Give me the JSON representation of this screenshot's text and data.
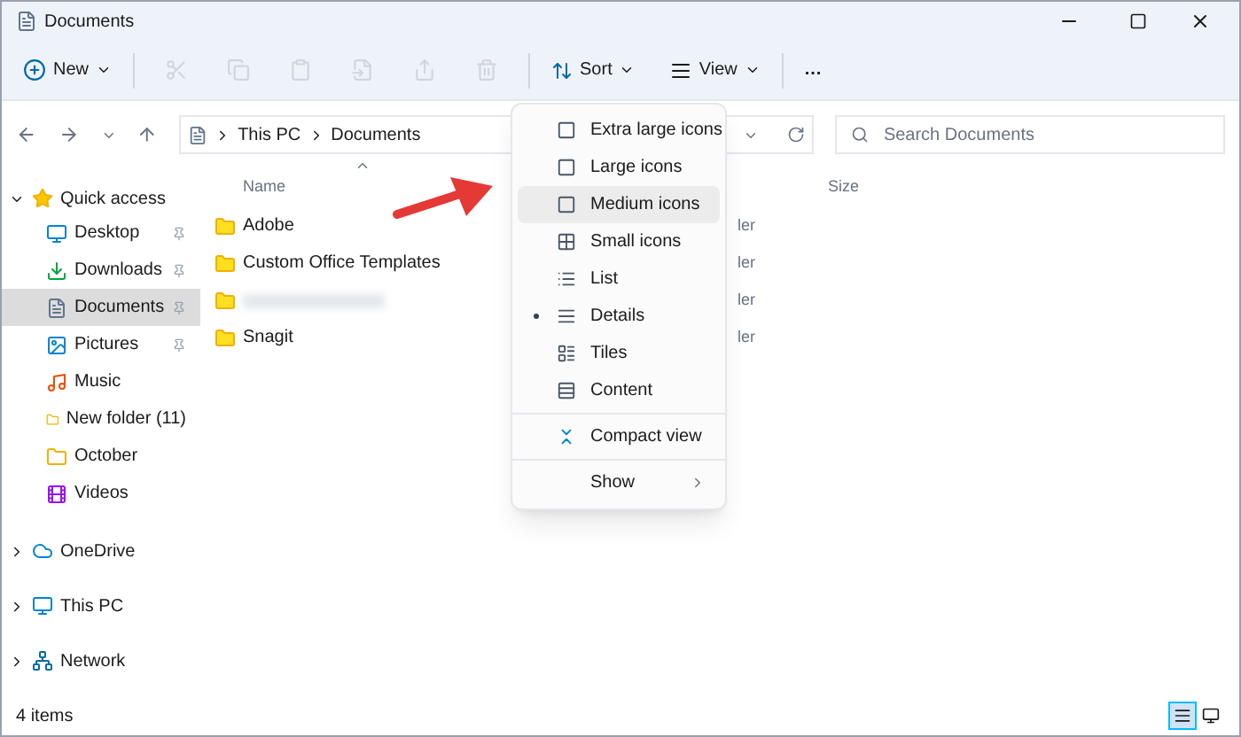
{
  "window": {
    "title": "Documents"
  },
  "toolbar": {
    "new_label": "New",
    "sort_label": "Sort",
    "view_label": "View",
    "more_label": "..."
  },
  "address": {
    "crumbs": [
      "This PC",
      "Documents"
    ],
    "search_placeholder": "Search Documents"
  },
  "columns": [
    "Name",
    "Size"
  ],
  "sidebar": [
    {
      "label": "Quick access",
      "expanded": true,
      "children": [
        {
          "label": "Desktop",
          "pinned": true,
          "selected": false
        },
        {
          "label": "Downloads",
          "pinned": true,
          "selected": false
        },
        {
          "label": "Documents",
          "pinned": true,
          "selected": true
        },
        {
          "label": "Pictures",
          "pinned": true,
          "selected": false
        },
        {
          "label": "Music",
          "pinned": false,
          "selected": false
        },
        {
          "label": "New folder (11)",
          "pinned": false,
          "selected": false
        },
        {
          "label": "October",
          "pinned": false,
          "selected": false
        },
        {
          "label": "Videos",
          "pinned": false,
          "selected": false
        }
      ]
    },
    {
      "label": "OneDrive",
      "expanded": false
    },
    {
      "label": "This PC",
      "expanded": false
    },
    {
      "label": "Network",
      "expanded": false
    }
  ],
  "files": [
    {
      "kind": "folder",
      "name": "Adobe",
      "type": "ler"
    },
    {
      "kind": "folder",
      "name": "Custom Office Templates",
      "type": "ler"
    },
    {
      "kind": "blurred",
      "type": "ler"
    },
    {
      "kind": "folder",
      "name": "Snagit",
      "type": "ler"
    }
  ],
  "view_menu": [
    {
      "label": "Extra large icons",
      "selected": false,
      "highlighted": false,
      "separator_before": false
    },
    {
      "label": "Large icons",
      "selected": false,
      "highlighted": false,
      "separator_before": false
    },
    {
      "label": "Medium icons",
      "selected": false,
      "highlighted": true,
      "separator_before": false
    },
    {
      "label": "Small icons",
      "selected": false,
      "highlighted": false,
      "separator_before": false
    },
    {
      "label": "List",
      "selected": false,
      "highlighted": false,
      "separator_before": false
    },
    {
      "label": "Details",
      "selected": true,
      "highlighted": false,
      "separator_before": false
    },
    {
      "label": "Tiles",
      "selected": false,
      "highlighted": false,
      "separator_before": false
    },
    {
      "label": "Content",
      "selected": false,
      "highlighted": false,
      "separator_before": false
    },
    {
      "label": "Compact view",
      "selected": false,
      "highlighted": false,
      "separator_before": true
    },
    {
      "label": "Show",
      "selected": false,
      "highlighted": false,
      "separator_before": true,
      "submenu": true
    }
  ],
  "status": {
    "count": "4 items",
    "views": [
      {
        "selected": true
      },
      {
        "selected": false
      }
    ]
  }
}
